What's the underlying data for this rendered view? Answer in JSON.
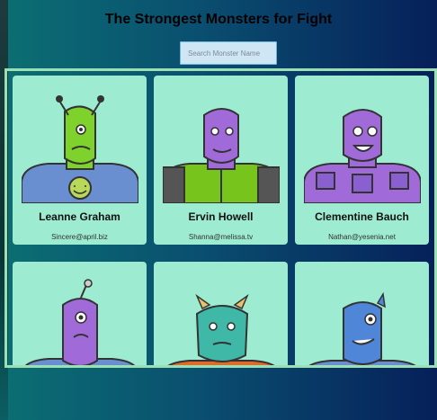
{
  "title": "The Strongest Monsters for Fight",
  "search": {
    "placeholder": "Search Monster Name"
  },
  "monsters": [
    {
      "name": "Leanne Graham",
      "email": "Sincere@april.biz",
      "body_color": "#7fd12b",
      "suit_color": "#6a8fd0"
    },
    {
      "name": "Ervin Howell",
      "email": "Shanna@melissa.tv",
      "body_color": "#a06ad8",
      "suit_color": "#77c41d"
    },
    {
      "name": "Clementine Bauch",
      "email": "Nathan@yesenia.net",
      "body_color": "#a06ad8",
      "suit_color": "#a06ad8"
    },
    {
      "name": "",
      "email": "",
      "body_color": "#a06ad8",
      "suit_color": "#6a8fd0"
    },
    {
      "name": "",
      "email": "",
      "body_color": "#3fb8a8",
      "suit_color": "#e06a2a"
    },
    {
      "name": "",
      "email": "",
      "body_color": "#4f86d8",
      "suit_color": "#6a8fd0"
    }
  ]
}
